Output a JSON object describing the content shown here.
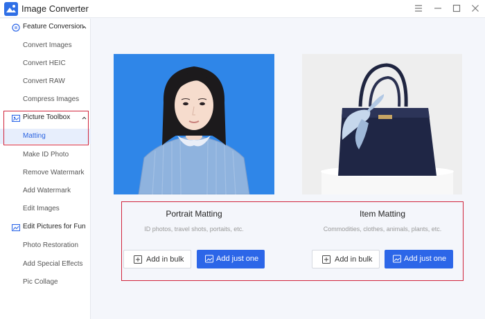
{
  "window": {
    "title": "Image Converter"
  },
  "sidebar": {
    "sections": [
      {
        "label": "Feature Conversion",
        "items": [
          "Convert Images",
          "Convert HEIC",
          "Convert RAW",
          "Compress Images"
        ]
      },
      {
        "label": "Picture Toolbox",
        "items": [
          "Matting",
          "Make ID Photo",
          "Remove Watermark",
          "Add Watermark",
          "Edit Images"
        ]
      },
      {
        "label": "Edit Pictures for Fun",
        "items": [
          "Photo Restoration",
          "Add Special Effects",
          "Pic Collage"
        ]
      }
    ],
    "active_item": "Matting"
  },
  "cards": [
    {
      "title": "Portrait Matting",
      "description": "ID photos, travel shots, portaits, etc.",
      "bulk_label": "Add in bulk",
      "one_label": "Add just one"
    },
    {
      "title": "Item Matting",
      "description": "Commodities, clothes, animals, plants, etc.",
      "bulk_label": "Add in bulk",
      "one_label": "Add just one"
    }
  ],
  "colors": {
    "accent": "#2c66e8",
    "highlight_border": "#d0233a",
    "portrait_bg": "#2f86e8"
  }
}
